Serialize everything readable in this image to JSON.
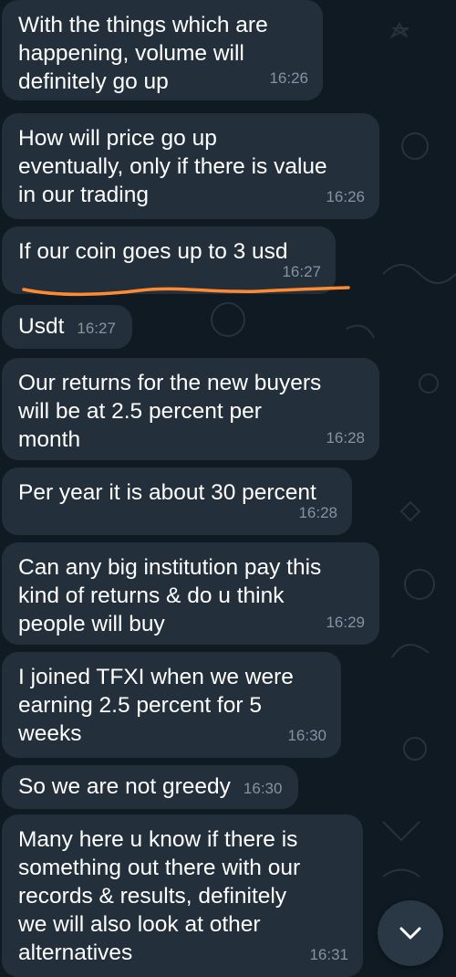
{
  "messages": [
    {
      "text": "With the things which are\nhappening, volume will\ndefinitely go up",
      "time": "16:26"
    },
    {
      "text": "How will price go up\neventually, only if there is value\nin our trading",
      "time": "16:26"
    },
    {
      "text": "If our coin goes up to 3 usd",
      "time": "16:27"
    },
    {
      "text": "Usdt",
      "time": "16:27"
    },
    {
      "text": "Our returns for the new buyers\nwill be at 2.5 percent per\nmonth",
      "time": "16:28"
    },
    {
      "text": "Per year it is about 30 percent",
      "time": "16:28"
    },
    {
      "text": "Can any big institution pay this\nkind of returns & do u think\npeople will buy",
      "time": "16:29"
    },
    {
      "text": "I joined TFXI when we were\nearning 2.5 percent for 5\nweeks",
      "time": "16:30"
    },
    {
      "text": "So we are not greedy",
      "time": "16:30"
    },
    {
      "text": "Many here u know if there is\nsomething out there with our\nrecords & results, definitely\nwe will also look at other\nalternatives",
      "time": "16:31"
    }
  ],
  "colors": {
    "background": "#0f1a22",
    "bubble": "#232f3b",
    "timestamp": "#8593a2",
    "underline_annotation": "#ff8a33"
  },
  "icons": [
    "chevron-down-icon"
  ]
}
